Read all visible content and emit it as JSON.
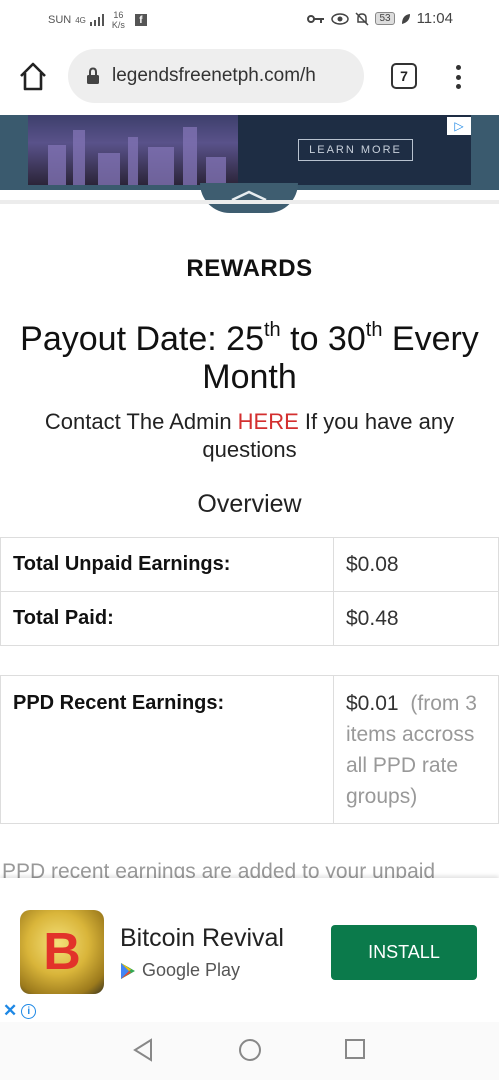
{
  "status_bar": {
    "carrier": "SUN",
    "network": "4G",
    "speed_value": "16",
    "speed_unit": "K/s",
    "battery": "53",
    "time": "11:04"
  },
  "browser": {
    "url": "legendsfreenetph.com/h",
    "tab_count": "7"
  },
  "top_ad": {
    "cta": "LEARN MORE"
  },
  "page": {
    "heading": "REWARDS",
    "payout_prefix": "Payout Date: 25",
    "payout_sup1": "th",
    "payout_mid": " to 30",
    "payout_sup2": "th",
    "payout_suffix": " Every Month",
    "contact_prefix": "Contact The Admin ",
    "contact_link": "HERE",
    "contact_suffix": " If you have any questions",
    "overview": "Overview"
  },
  "earnings_table": {
    "rows": [
      {
        "label": "Total Unpaid Earnings:",
        "value": "$0.08"
      },
      {
        "label": "Total Paid:",
        "value": "$0.48"
      }
    ]
  },
  "ppd_table": {
    "label": "PPD Recent Earnings:",
    "value": "$0.01",
    "note": "(from 3 items accross all PPD rate groups)"
  },
  "cut_text": "PPD recent earnings are added to your unpaid",
  "bottom_ad": {
    "title": "Bitcoin Revival",
    "store": "Google Play",
    "install": "INSTALL",
    "icon_glyph": "B"
  },
  "colors": {
    "install": "#0b7a4b",
    "link": "#d32f2f",
    "ad_banner": "#3a5a6e"
  }
}
